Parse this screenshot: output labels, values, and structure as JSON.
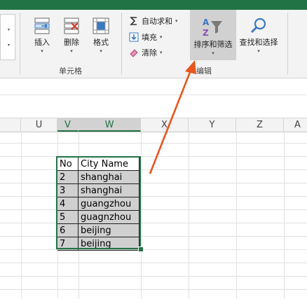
{
  "ribbon": {
    "cells_group": {
      "label": "单元格",
      "insert": "插入",
      "delete": "删除",
      "format": "格式"
    },
    "editing_group": {
      "label": "编辑",
      "autosum": "自动求和",
      "fill": "填充",
      "clear": "清除",
      "sort_filter": "排序和筛选",
      "find_select": "查找和选择"
    }
  },
  "columns": [
    "U",
    "V",
    "W",
    "X",
    "Y",
    "Z",
    "A"
  ],
  "selected_columns": [
    "V",
    "W"
  ],
  "table": {
    "headers": [
      "No",
      "City Name"
    ],
    "rows": [
      [
        "2",
        "shanghai"
      ],
      [
        "3",
        "shanghai"
      ],
      [
        "4",
        "guangzhou"
      ],
      [
        "5",
        "guagnzhou"
      ],
      [
        "6",
        "beijing"
      ],
      [
        "7",
        "beijing"
      ]
    ]
  },
  "colors": {
    "accent": "#217346",
    "arrow": "#e8551f",
    "selection_fill": "#d0d0d0"
  }
}
